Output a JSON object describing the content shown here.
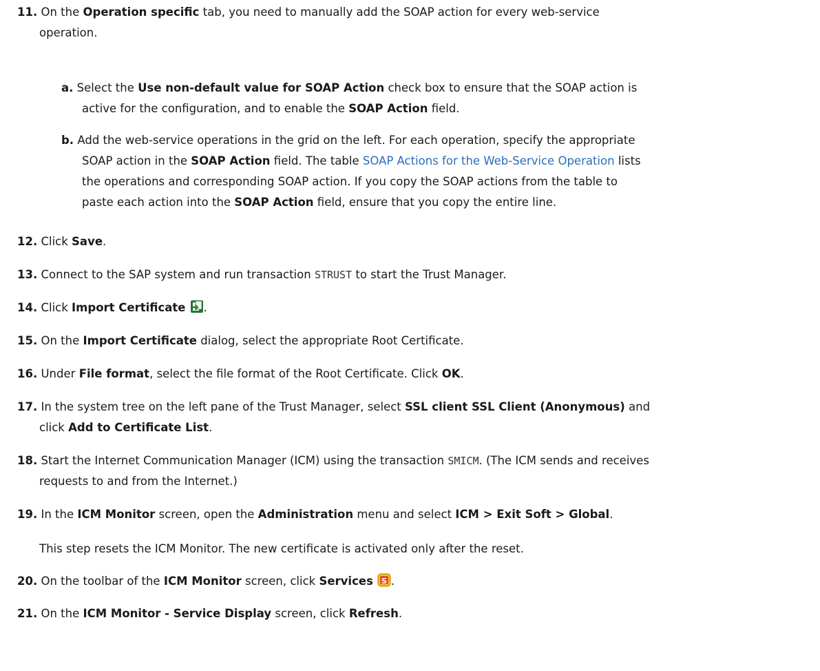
{
  "steps": {
    "s11": {
      "num": "11.",
      "t1": "On the ",
      "b1": "Operation specific",
      "t2": " tab, you need to manually add the SOAP action for every web-service",
      "t3": "operation."
    },
    "s11a": {
      "num": "a.",
      "t1": "Select the ",
      "b1": "Use non-default value for SOAP Action",
      "t2": " check box to ensure that the SOAP action is",
      "t3": "active for the configuration, and to enable the ",
      "b2": "SOAP Action",
      "t4": " field."
    },
    "s11b": {
      "num": "b.",
      "t1": "Add the web-service operations in the grid on the left. For each operation, specify the appropriate",
      "t2": "SOAP action in the ",
      "b1": "SOAP Action",
      "t3": " field. The table ",
      "link": "SOAP Actions for the Web-Service Operation",
      "t4": " lists",
      "t5": "the operations and corresponding SOAP action. If you copy the SOAP actions from the table to",
      "t6": "paste each action into the ",
      "b2": "SOAP Action",
      "t7": " field, ensure that you copy the entire line."
    },
    "s12": {
      "num": "12.",
      "t1": "Click ",
      "b1": "Save",
      "t2": "."
    },
    "s13": {
      "num": "13.",
      "t1": "Connect to the SAP system and run transaction ",
      "code": "STRUST",
      "t2": " to start the Trust Manager."
    },
    "s14": {
      "num": "14.",
      "t1": "Click ",
      "b1": "Import Certificate",
      "t2": "."
    },
    "s15": {
      "num": "15.",
      "t1": "On the ",
      "b1": "Import Certificate",
      "t2": " dialog, select the appropriate Root Certificate."
    },
    "s16": {
      "num": "16.",
      "t1": "Under ",
      "b1": "File format",
      "t2": ", select the file format of the Root Certificate. Click ",
      "b2": "OK",
      "t3": "."
    },
    "s17": {
      "num": "17.",
      "t1": "In the system tree on the left pane of the Trust Manager, select ",
      "b1": "SSL client SSL Client (Anonymous)",
      "t2": " and",
      "t3": "click ",
      "b2": "Add to Certificate List",
      "t4": "."
    },
    "s18": {
      "num": "18.",
      "t1": "Start the Internet Communication Manager (ICM) using the transaction ",
      "code": "SMICM",
      "t2": ". (The ICM sends and receives",
      "t3": "requests to and from the Internet.)"
    },
    "s19": {
      "num": "19.",
      "t1": "In the ",
      "b1": "ICM Monitor",
      "t2": " screen, open the ",
      "b2": "Administration",
      "t3": " menu and select ",
      "b3": "ICM > Exit Soft > Global",
      "t4": ".",
      "note": "This step resets the ICM Monitor. The new certificate is activated only after the reset."
    },
    "s20": {
      "num": "20.",
      "t1": "On the toolbar of the ",
      "b1": "ICM Monitor",
      "t2": " screen, click ",
      "b2": "Services",
      "t3": "."
    },
    "s21": {
      "num": "21.",
      "t1": "On the ",
      "b1": "ICM Monitor - Service Display",
      "t2": " screen, click ",
      "b2": "Refresh",
      "t3": "."
    }
  },
  "icons": {
    "import": "import-certificate-icon",
    "services": "services-icon"
  }
}
